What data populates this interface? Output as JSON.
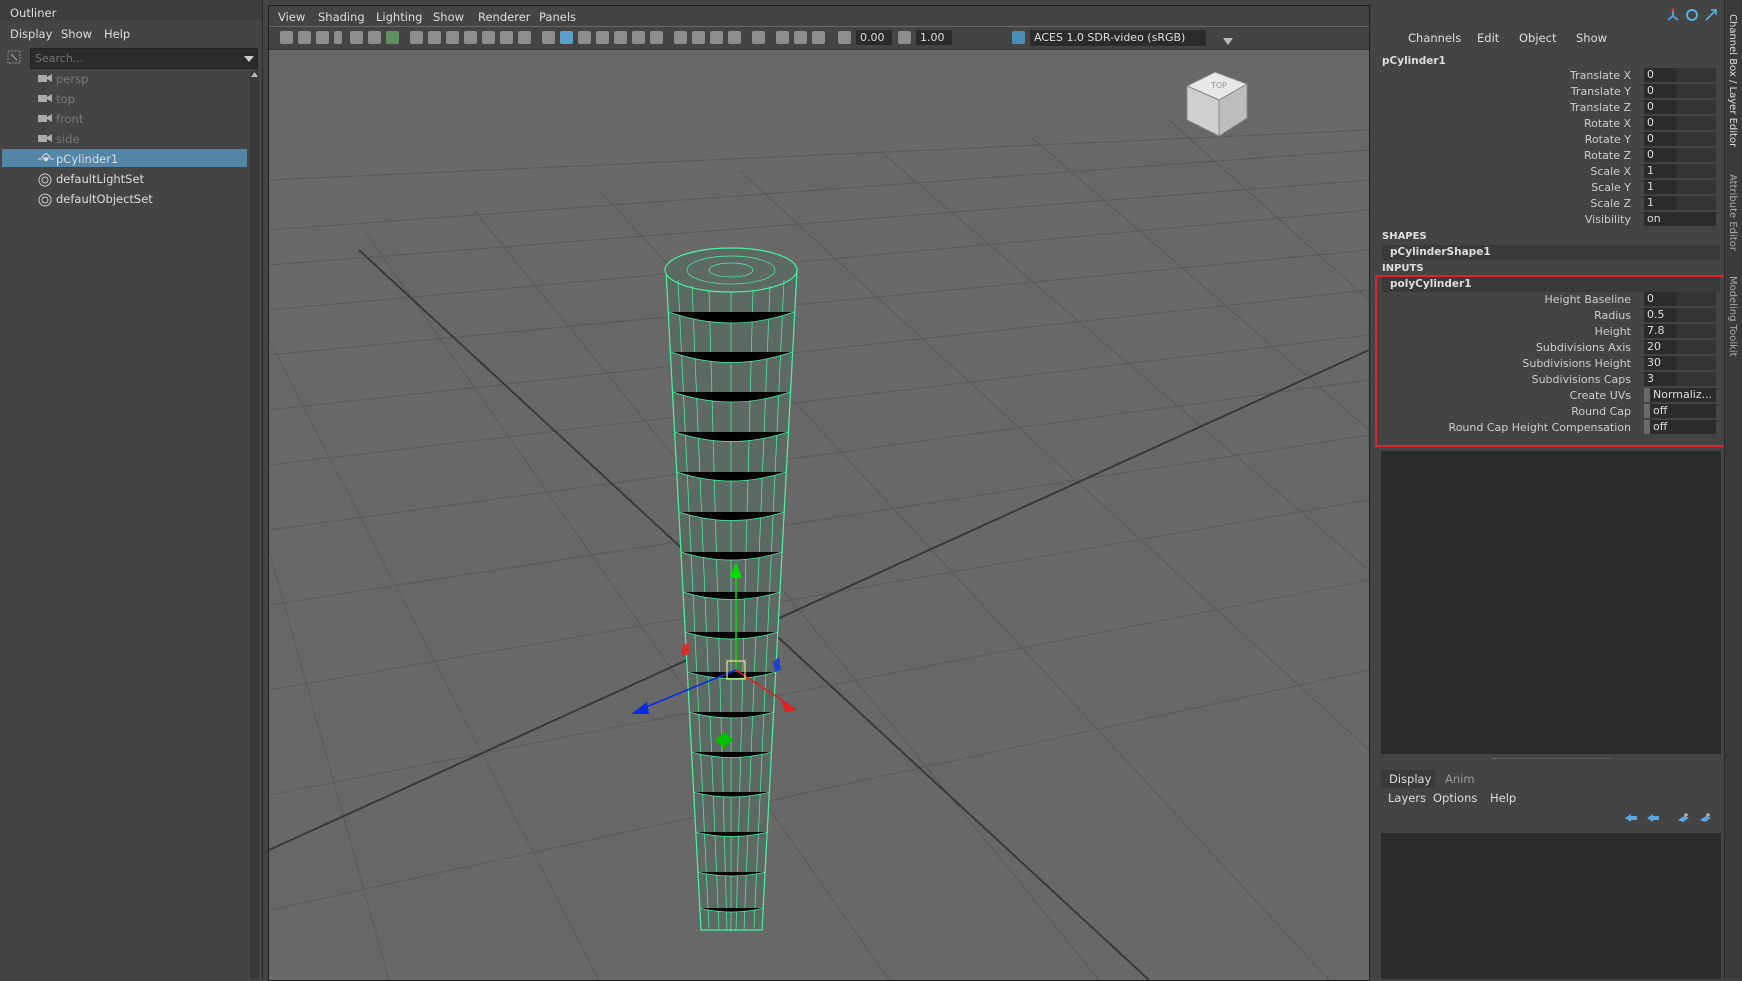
{
  "outliner": {
    "title": "Outliner",
    "menu": [
      "Display",
      "Show",
      "Help"
    ],
    "search_placeholder": "Search...",
    "items": [
      {
        "label": "persp",
        "icon": "camera-icon"
      },
      {
        "label": "top",
        "icon": "camera-icon"
      },
      {
        "label": "front",
        "icon": "camera-icon"
      },
      {
        "label": "side",
        "icon": "camera-icon"
      },
      {
        "label": "pCylinder1",
        "icon": "transform-icon",
        "selected": true
      },
      {
        "label": "defaultLightSet",
        "icon": "set-icon"
      },
      {
        "label": "defaultObjectSet",
        "icon": "set-icon"
      }
    ]
  },
  "viewport": {
    "menu": [
      "View",
      "Shading",
      "Lighting",
      "Show",
      "Renderer",
      "Panels"
    ],
    "toolbar": {
      "exposure": "0.00",
      "gamma": "1.00",
      "colorspace": "ACES 1.0 SDR-video (sRGB)"
    },
    "view_cube_label": "TOP"
  },
  "channel_box": {
    "menu": [
      "Channels",
      "Edit",
      "Object",
      "Show"
    ],
    "object_name": "pCylinder1",
    "transform_attrs": [
      {
        "name": "Translate X",
        "value": "0"
      },
      {
        "name": "Translate Y",
        "value": "0"
      },
      {
        "name": "Translate Z",
        "value": "0"
      },
      {
        "name": "Rotate X",
        "value": "0"
      },
      {
        "name": "Rotate Y",
        "value": "0"
      },
      {
        "name": "Rotate Z",
        "value": "0"
      },
      {
        "name": "Scale X",
        "value": "1"
      },
      {
        "name": "Scale Y",
        "value": "1"
      },
      {
        "name": "Scale Z",
        "value": "1"
      },
      {
        "name": "Visibility",
        "value": "on"
      }
    ],
    "shapes_label": "SHAPES",
    "shape_name": "pCylinderShape1",
    "inputs_label": "INPUTS",
    "input_name": "polyCylinder1",
    "input_attrs": [
      {
        "name": "Height Baseline",
        "value": "0"
      },
      {
        "name": "Radius",
        "value": "0.5"
      },
      {
        "name": "Height",
        "value": "7.8"
      },
      {
        "name": "Subdivisions Axis",
        "value": "20"
      },
      {
        "name": "Subdivisions Height",
        "value": "30"
      },
      {
        "name": "Subdivisions Caps",
        "value": "3"
      },
      {
        "name": "Create UVs",
        "value": "Normaliz..."
      },
      {
        "name": "Round Cap",
        "value": "off"
      },
      {
        "name": "Round Cap Height Compensation",
        "value": "off"
      }
    ],
    "side_tabs": [
      "Channel Box / Layer Editor",
      "Attribute Editor",
      "Modeling Toolkit"
    ]
  },
  "layer_editor": {
    "tabs": [
      "Display",
      "Anim"
    ],
    "menu": [
      "Layers",
      "Options",
      "Help"
    ]
  },
  "colors": {
    "selection": "#5285a6",
    "highlight_box": "#e0202a",
    "wireframe": "#47f5a0"
  }
}
